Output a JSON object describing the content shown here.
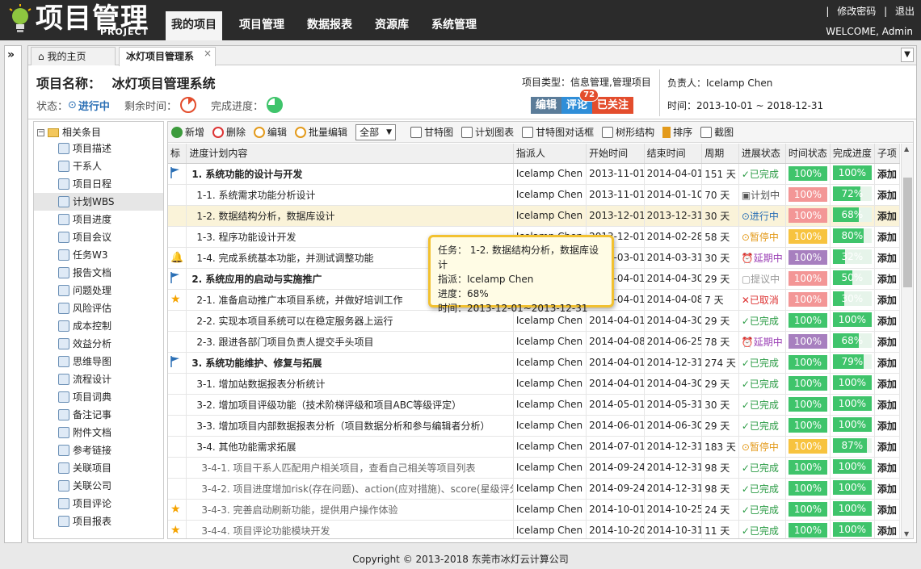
{
  "app": {
    "logo_main": "项目管理",
    "logo_sub": "PROJECT"
  },
  "nav": [
    {
      "label": "我的项目",
      "active": true
    },
    {
      "label": "项目管理"
    },
    {
      "label": "数据报表"
    },
    {
      "label": "资源库"
    },
    {
      "label": "系统管理"
    }
  ],
  "top_links": {
    "change_password": "修改密码",
    "logout": "退出",
    "separator": "|"
  },
  "welcome": "WELCOME, Admin",
  "tabs": [
    {
      "label": "我的主页"
    },
    {
      "label": "冰灯项目管理系"
    }
  ],
  "tab_close": "×",
  "project": {
    "name_label": "项目名称：",
    "name": "冰灯项目管理系统",
    "status_label": "状态：",
    "status": "进行中",
    "remaining_label": "剩余时间：",
    "completion_label": "完成进度：",
    "type": "项目类型：信息管理,管理项目",
    "owner": "负责人：Icelamp Chen",
    "time": "时间：2013-10-01 ~ 2018-12-31",
    "btn_edit": "编辑",
    "btn_comment": "评论",
    "comment_count": "72",
    "btn_follow": "已关注"
  },
  "tree": {
    "root": "相关条目",
    "items": [
      {
        "label": "项目描述",
        "icon": "doc-icon"
      },
      {
        "label": "干系人",
        "icon": "user-icon"
      },
      {
        "label": "项目日程",
        "icon": "calendar-icon"
      },
      {
        "label": "计划WBS",
        "icon": "wbs-icon",
        "selected": true
      },
      {
        "label": "项目进度",
        "icon": "progress-icon"
      },
      {
        "label": "项目会议",
        "icon": "meeting-icon"
      },
      {
        "label": "任务W3",
        "icon": "task-icon"
      },
      {
        "label": "报告文档",
        "icon": "report-icon"
      },
      {
        "label": "问题处理",
        "icon": "warning-icon"
      },
      {
        "label": "风险评估",
        "icon": "bomb-icon"
      },
      {
        "label": "成本控制",
        "icon": "yen-icon"
      },
      {
        "label": "效益分析",
        "icon": "yen-icon"
      },
      {
        "label": "思维导图",
        "icon": "mindmap-icon"
      },
      {
        "label": "流程设计",
        "icon": "flow-icon"
      },
      {
        "label": "项目词典",
        "icon": "dictionary-icon"
      },
      {
        "label": "备注记事",
        "icon": "note-icon"
      },
      {
        "label": "附件文档",
        "icon": "attachment-icon"
      },
      {
        "label": "参考链接",
        "icon": "link-icon"
      },
      {
        "label": "关联项目",
        "icon": "chart-icon"
      },
      {
        "label": "关联公司",
        "icon": "company-icon"
      },
      {
        "label": "项目评论",
        "icon": "comment-icon"
      },
      {
        "label": "项目报表",
        "icon": "table-icon"
      }
    ]
  },
  "toolbar": {
    "add": "新增",
    "delete": "删除",
    "edit": "编辑",
    "batch_edit": "批量编辑",
    "filter": "全部",
    "gantt": "甘特图",
    "plan_chart": "计划图表",
    "gantt_dialog": "甘特图对话框",
    "tree_struct": "树形结构",
    "sort": "排序",
    "screenshot": "截图"
  },
  "columns": [
    "标",
    "进度计划内容",
    "指派人",
    "开始时间",
    "结束时间",
    "周期",
    "进展状态",
    "时间状态",
    "完成进度",
    "子项"
  ],
  "rows": [
    {
      "mark": "flag",
      "level": 0,
      "name": "1. 系统功能的设计与开发",
      "assignee": "Icelamp Chen",
      "start": "2013-11-01",
      "end": "2014-04-01",
      "period": "151 天",
      "status": "已完成",
      "status_type": "done",
      "time_status": "100%",
      "time_color": "green",
      "progress": 100,
      "progress_text": "100%",
      "sub": "添加"
    },
    {
      "mark": "",
      "level": 1,
      "name": "1-1. 系统需求功能分析设计",
      "assignee": "Icelamp Chen",
      "start": "2013-11-01",
      "end": "2014-01-10",
      "period": "70 天",
      "status": "计划中",
      "status_type": "plan",
      "time_status": "100%",
      "time_color": "red",
      "progress": 72,
      "progress_text": "72%",
      "sub": "添加"
    },
    {
      "mark": "",
      "level": 1,
      "name": "1-2. 数据结构分析，数据库设计",
      "assignee": "Icelamp Chen",
      "start": "2013-12-01",
      "end": "2013-12-31",
      "period": "30 天",
      "status": "进行中",
      "status_type": "doing",
      "time_status": "100%",
      "time_color": "red",
      "progress": 68,
      "progress_text": "68%",
      "sub": "添加",
      "highlight": true
    },
    {
      "mark": "",
      "level": 1,
      "name": "1-3. 程序功能设计开发",
      "assignee": "Icelamp Chen",
      "start": "2013-12-01",
      "end": "2014-02-28",
      "period": "58 天",
      "status": "暂停中",
      "status_type": "pause",
      "time_status": "100%",
      "time_color": "yellow",
      "progress": 80,
      "progress_text": "80%",
      "sub": "添加"
    },
    {
      "mark": "bell",
      "level": 1,
      "name": "1-4. 完成系统基本功能，并测试调整功能",
      "assignee": "Icelamp Chen",
      "start": "2014-03-01",
      "end": "2014-03-31",
      "period": "30 天",
      "status": "延期中",
      "status_type": "delay",
      "time_status": "100%",
      "time_color": "purple",
      "progress": 32,
      "progress_text": "32%",
      "sub": "添加"
    },
    {
      "mark": "flag",
      "level": 0,
      "name": "2. 系统应用的启动与实施推广",
      "assignee": "Icelamp Chen",
      "start": "2014-04-01",
      "end": "2014-04-30",
      "period": "29 天",
      "status": "提议中",
      "status_type": "lift",
      "time_status": "100%",
      "time_color": "red",
      "progress": 50,
      "progress_text": "50%",
      "sub": "添加"
    },
    {
      "mark": "star",
      "level": 1,
      "name": "2-1. 准备启动推广本项目系统，并做好培训工作",
      "assignee": "Icelamp Chen",
      "start": "2014-04-01",
      "end": "2014-04-08",
      "period": "7 天",
      "status": "已取消",
      "status_type": "cancel",
      "time_status": "100%",
      "time_color": "red",
      "progress": 30,
      "progress_text": "30%",
      "sub": "添加"
    },
    {
      "mark": "",
      "level": 1,
      "name": "2-2. 实现本项目系统可以在稳定服务器上运行",
      "assignee": "Icelamp Chen",
      "start": "2014-04-01",
      "end": "2014-04-30",
      "period": "29 天",
      "status": "已完成",
      "status_type": "done",
      "time_status": "100%",
      "time_color": "green",
      "progress": 100,
      "progress_text": "100%",
      "sub": "添加"
    },
    {
      "mark": "",
      "level": 1,
      "name": "2-3. 跟进各部门项目负责人提交手头项目",
      "assignee": "Icelamp Chen",
      "start": "2014-04-08",
      "end": "2014-06-25",
      "period": "78 天",
      "status": "延期中",
      "status_type": "delay",
      "time_status": "100%",
      "time_color": "purple",
      "progress": 68,
      "progress_text": "68%",
      "sub": "添加"
    },
    {
      "mark": "flag",
      "level": 0,
      "name": "3. 系统功能维护、修复与拓展",
      "assignee": "Icelamp Chen",
      "start": "2014-04-01",
      "end": "2014-12-31",
      "period": "274 天",
      "status": "已完成",
      "status_type": "done",
      "time_status": "100%",
      "time_color": "green",
      "progress": 79,
      "progress_text": "79%",
      "sub": "添加"
    },
    {
      "mark": "",
      "level": 1,
      "name": "3-1. 增加站数据报表分析统计",
      "assignee": "Icelamp Chen",
      "start": "2014-04-01",
      "end": "2014-04-30",
      "period": "29 天",
      "status": "已完成",
      "status_type": "done",
      "time_status": "100%",
      "time_color": "green",
      "progress": 100,
      "progress_text": "100%",
      "sub": "添加"
    },
    {
      "mark": "",
      "level": 1,
      "name": "3-2. 增加项目评级功能（技术阶梯评级和项目ABC等级评定）",
      "assignee": "Icelamp Chen",
      "start": "2014-05-01",
      "end": "2014-05-31",
      "period": "30 天",
      "status": "已完成",
      "status_type": "done",
      "time_status": "100%",
      "time_color": "green",
      "progress": 100,
      "progress_text": "100%",
      "sub": "添加"
    },
    {
      "mark": "",
      "level": 1,
      "name": "3-3. 增加项目内部数据报表分析（项目数据分析和参与编辑者分析）",
      "assignee": "Icelamp Chen",
      "start": "2014-06-01",
      "end": "2014-06-30",
      "period": "29 天",
      "status": "已完成",
      "status_type": "done",
      "time_status": "100%",
      "time_color": "green",
      "progress": 100,
      "progress_text": "100%",
      "sub": "添加"
    },
    {
      "mark": "",
      "level": 1,
      "name": "3-4. 其他功能需求拓展",
      "assignee": "Icelamp Chen",
      "start": "2014-07-01",
      "end": "2014-12-31",
      "period": "183 天",
      "status": "暂停中",
      "status_type": "pause",
      "time_status": "100%",
      "time_color": "yellow",
      "progress": 87,
      "progress_text": "87%",
      "sub": "添加"
    },
    {
      "mark": "",
      "level": 2,
      "name": "3-4-1. 项目干系人匹配用户相关项目，查看自己相关等项目列表",
      "assignee": "Icelamp Chen",
      "start": "2014-09-24",
      "end": "2014-12-31",
      "period": "98 天",
      "status": "已完成",
      "status_type": "done",
      "time_status": "100%",
      "time_color": "green",
      "progress": 100,
      "progress_text": "100%",
      "sub": "添加"
    },
    {
      "mark": "",
      "level": 2,
      "name": "3-4-2. 项目进度增加risk(存在问题)、action(应对措施)、score(星级评分)",
      "assignee": "Icelamp Chen",
      "start": "2014-09-24",
      "end": "2014-12-31",
      "period": "98 天",
      "status": "已完成",
      "status_type": "done",
      "time_status": "100%",
      "time_color": "green",
      "progress": 100,
      "progress_text": "100%",
      "sub": "添加"
    },
    {
      "mark": "star",
      "level": 2,
      "name": "3-4-3. 完善启动刷新功能，提供用户操作体验",
      "assignee": "Icelamp Chen",
      "start": "2014-10-01",
      "end": "2014-10-25",
      "period": "24 天",
      "status": "已完成",
      "status_type": "done",
      "time_status": "100%",
      "time_color": "green",
      "progress": 100,
      "progress_text": "100%",
      "sub": "添加"
    },
    {
      "mark": "star",
      "level": 2,
      "name": "3-4-4. 项目评论功能模块开发",
      "assignee": "Icelamp Chen",
      "start": "2014-10-20",
      "end": "2014-10-31",
      "period": "11 天",
      "status": "已完成",
      "status_type": "done",
      "time_status": "100%",
      "time_color": "green",
      "progress": 100,
      "progress_text": "100%",
      "sub": "添加"
    }
  ],
  "tooltip": {
    "task": "任务： 1-2. 数据结构分析，数据库设计",
    "assignee": "指派：Icelamp Chen",
    "progress": "进度：68%",
    "time": "时间：2013-12-01~2013-12-31"
  },
  "footer": "Copyright © 2013-2018 东莞市冰灯云计算公司"
}
